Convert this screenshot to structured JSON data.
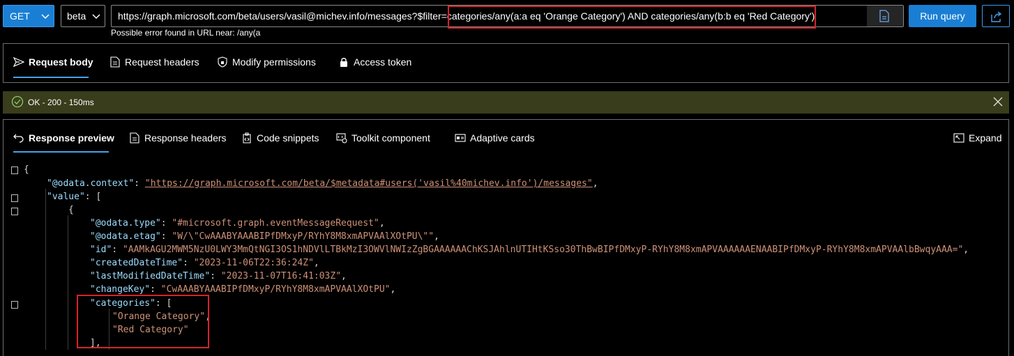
{
  "topbar": {
    "method": "GET",
    "version": "beta",
    "url": "https://graph.microsoft.com/beta/users/vasil@michev.info/messages?$filter=categories/any(a:a eq 'Orange Category') AND categories/any(b:b eq 'Red Category')",
    "url_error": "Possible error found in URL near: /any(a",
    "run_label": "Run query"
  },
  "request_tabs": [
    {
      "label": "Request body",
      "icon": "send-icon",
      "active": true
    },
    {
      "label": "Request headers",
      "icon": "document-icon",
      "active": false
    },
    {
      "label": "Modify permissions",
      "icon": "shield-lock-icon",
      "active": false
    },
    {
      "label": "Access token",
      "icon": "lock-icon",
      "active": false
    }
  ],
  "status": {
    "text": "OK - 200 - 150ms",
    "color": "#393d1b"
  },
  "response_tabs": [
    {
      "label": "Response preview",
      "icon": "undo-arrow-icon",
      "active": true
    },
    {
      "label": "Response headers",
      "icon": "document-icon",
      "active": false
    },
    {
      "label": "Code snippets",
      "icon": "code-clipboard-icon",
      "active": false
    },
    {
      "label": "Toolkit component",
      "icon": "toolkit-icon",
      "active": false
    },
    {
      "label": "Adaptive cards",
      "icon": "card-icon",
      "active": false
    }
  ],
  "expand_label": "Expand",
  "json_preview": {
    "open_brace": "{",
    "context_key": "\"@odata.context\"",
    "context_value": "\"https://graph.microsoft.com/beta/$metadata#users('vasil%40michev.info')/messages\"",
    "value_key": "\"value\"",
    "item_open": "{",
    "fields": [
      {
        "key": "\"@odata.type\"",
        "value": "\"#microsoft.graph.eventMessageRequest\""
      },
      {
        "key": "\"@odata.etag\"",
        "value": "\"W/\\\"CwAAABYAAABIPfDMxyP/RYhY8M8xmAPVAAlXOtPU\\\"\""
      },
      {
        "key": "\"id\"",
        "value": "\"AAMkAGU2MWM5NzU0LWY3MmQtNGI3OS1hNDVlLTBkMzI3OWVlNWIzZgBGAAAAAAChKSJAhlnUTIHtKSso30ThBwBIPfDMxyP-RYhY8M8xmAPVAAAAAAENAABIPfDMxyP-RYhY8M8xmAPVAAlbBwqyAAA=\""
      },
      {
        "key": "\"createdDateTime\"",
        "value": "\"2023-11-06T22:36:24Z\""
      },
      {
        "key": "\"lastModifiedDateTime\"",
        "value": "\"2023-11-07T16:41:03Z\""
      },
      {
        "key": "\"changeKey\"",
        "value": "\"CwAAABYAAABIPfDMxyP/RYhY8M8xmAPVAAlXOtPU\""
      }
    ],
    "categories_key": "\"categories\"",
    "categories": [
      "\"Orange Category\"",
      "\"Red Category\""
    ]
  }
}
